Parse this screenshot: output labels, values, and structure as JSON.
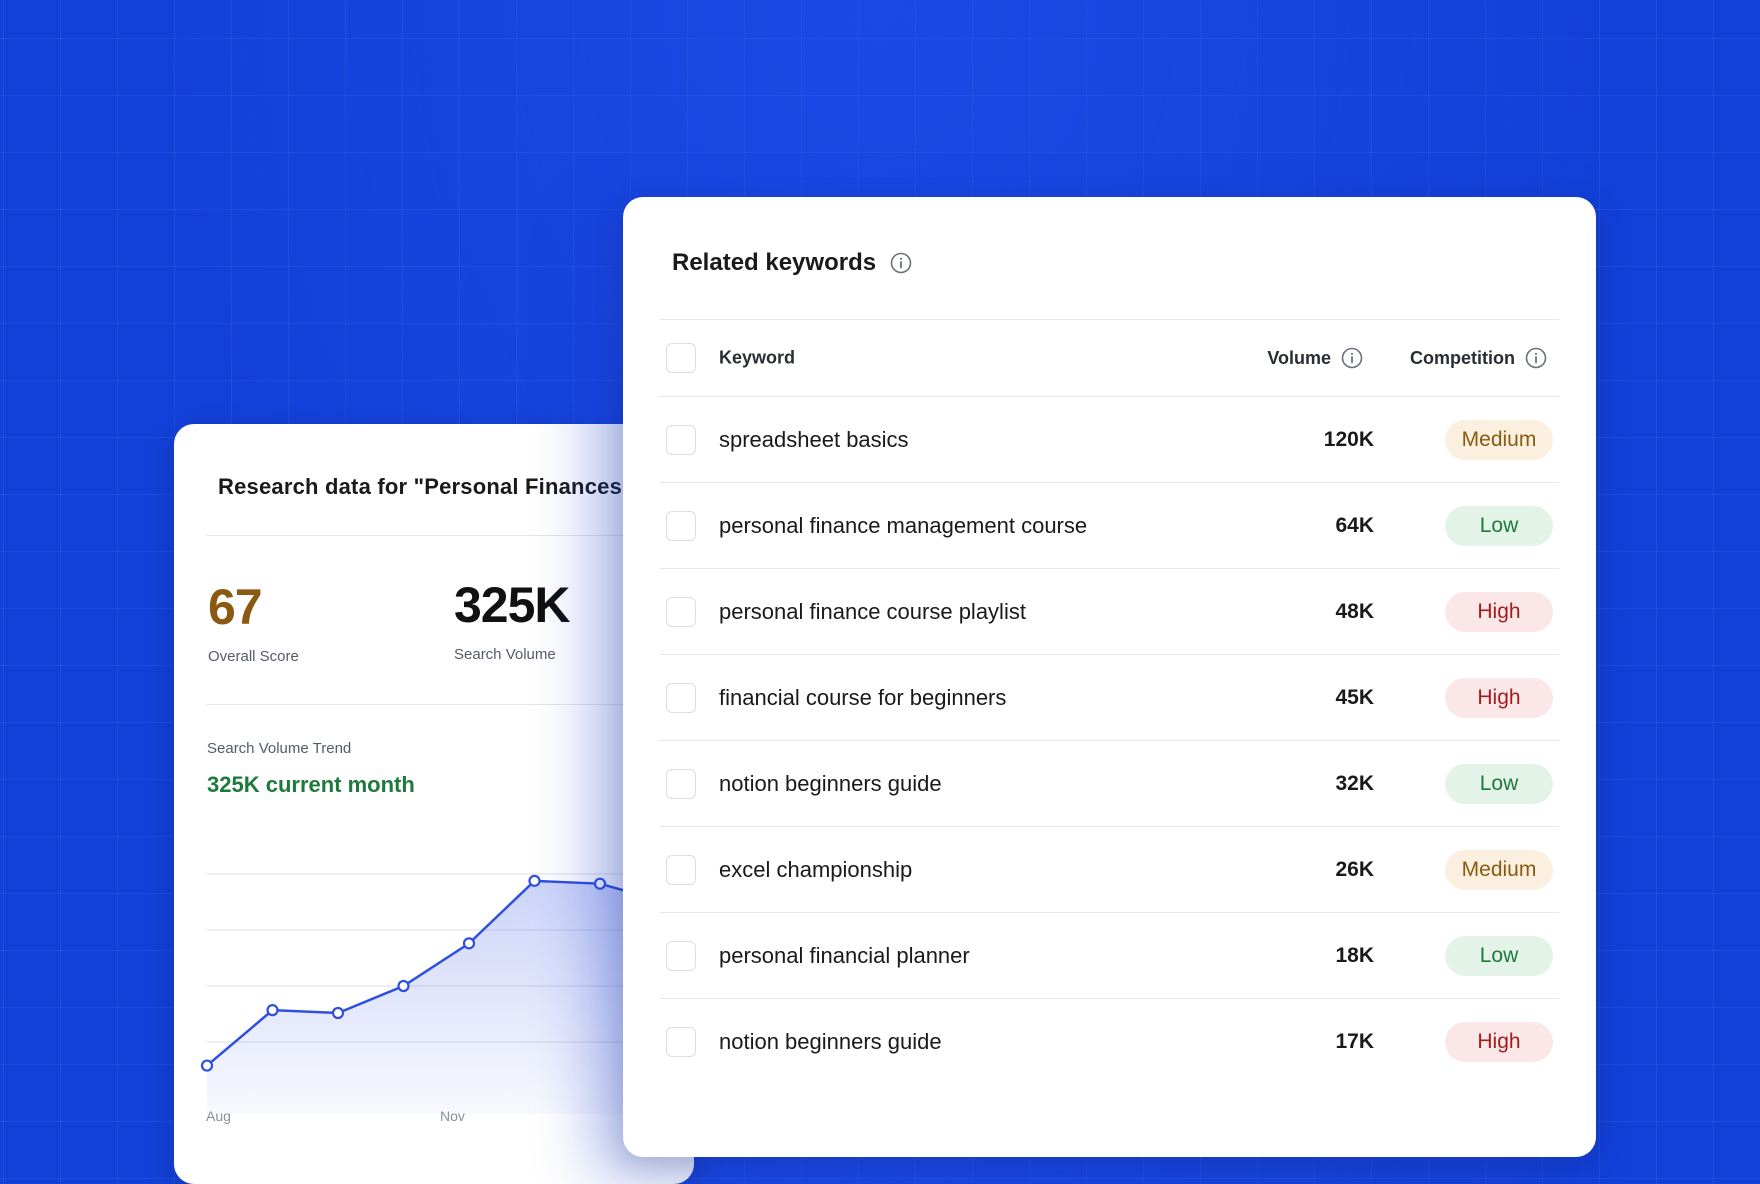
{
  "research_card": {
    "title": "Research data for \"Personal Finances",
    "overall_score": {
      "value": "67",
      "label": "Overall Score",
      "color": "#8a5a10"
    },
    "search_volume": {
      "value": "325K",
      "label": "Search Volume"
    },
    "trend": {
      "label": "Search Volume Trend",
      "subtitle": "325K current month",
      "axis_labels": [
        "Aug",
        "Nov"
      ]
    }
  },
  "chart_data": {
    "type": "line",
    "title": "Search Volume Trend",
    "x": [
      "Aug",
      "",
      "",
      "Nov",
      "",
      "",
      "",
      ""
    ],
    "series": [
      {
        "name": "",
        "values": [
          40,
          118,
          114,
          152,
          212,
          300,
          296,
          270
        ]
      }
    ],
    "ylim": [
      0,
      380
    ],
    "grid": true,
    "color": "#2f4fe0"
  },
  "keywords_card": {
    "title": "Related keywords",
    "title_icon": "info-icon",
    "columns": {
      "keyword": "Keyword",
      "volume": "Volume",
      "competition": "Competition"
    },
    "rows": [
      {
        "keyword": "spreadsheet basics",
        "volume": "120K",
        "competition": "Medium",
        "level": "medium"
      },
      {
        "keyword": "personal finance management course",
        "volume": "64K",
        "competition": "Low",
        "level": "low"
      },
      {
        "keyword": "personal finance course playlist",
        "volume": "48K",
        "competition": "High",
        "level": "high"
      },
      {
        "keyword": "financial course for beginners",
        "volume": "45K",
        "competition": "High",
        "level": "high"
      },
      {
        "keyword": "notion beginners guide",
        "volume": "32K",
        "competition": "Low",
        "level": "low"
      },
      {
        "keyword": "excel championship",
        "volume": "26K",
        "competition": "Medium",
        "level": "medium"
      },
      {
        "keyword": "personal financial planner",
        "volume": "18K",
        "competition": "Low",
        "level": "low"
      },
      {
        "keyword": "notion beginners guide",
        "volume": "17K",
        "competition": "High",
        "level": "high"
      }
    ]
  },
  "colors": {
    "background": "#1340d8",
    "medium": "#8a5a10",
    "low": "#1e7a3c",
    "high": "#a31d1d"
  }
}
